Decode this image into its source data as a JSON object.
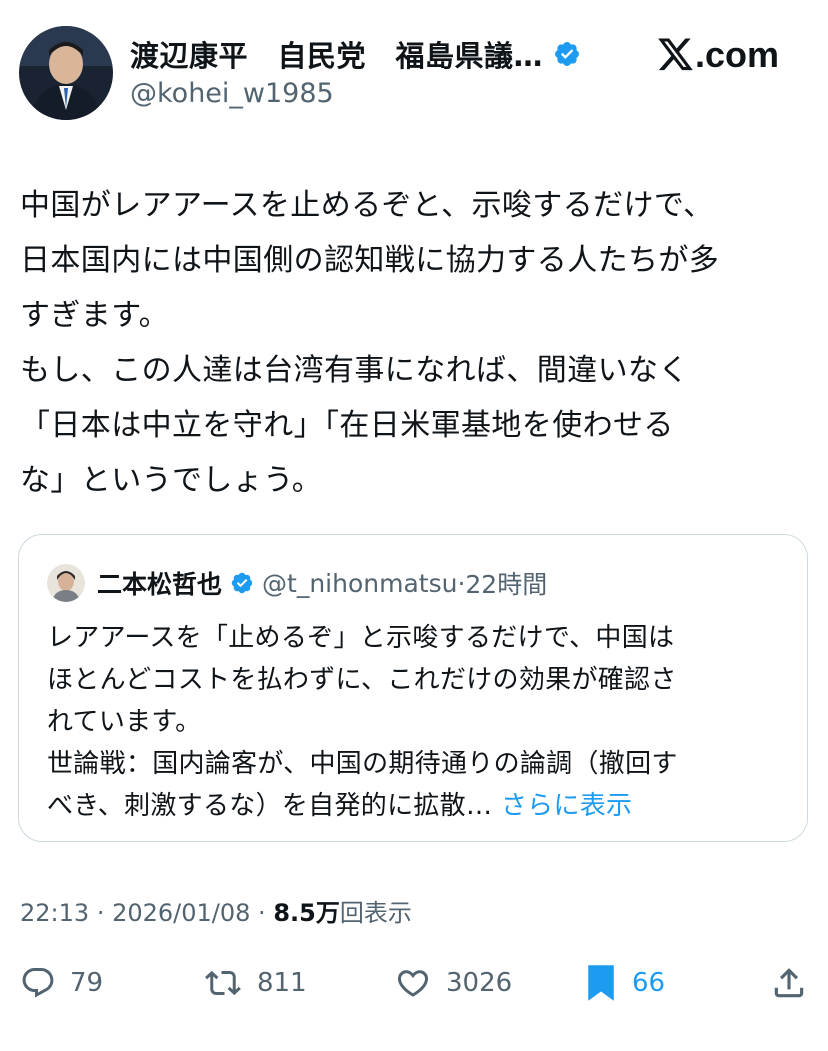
{
  "author": {
    "name": "渡辺康平　自民党　福島県議…",
    "handle": "@kohei_w1985"
  },
  "brand": {
    "logo_text": "com"
  },
  "tweet": {
    "lines": [
      "中国がレアアースを止めるぞと、示唆するだけで、",
      "日本国内には中国側の認知戦に協力する人たちが多",
      "すぎます。",
      "もし、この人達は台湾有事になれば、間違いなく",
      "「日本は中立を守れ」「在日米軍基地を使わせる",
      "な」というでしょう。"
    ]
  },
  "quote": {
    "name": "二本松哲也",
    "handle": "@t_nihonmatsu",
    "time": "22時間",
    "lines": [
      "レアアースを「止めるぞ」と示唆するだけで、中国は",
      "ほとんどコストを払わずに、これだけの効果が確認さ",
      "れています。",
      "世論戦：国内論客が、中国の期待通りの論調（撤回す"
    ],
    "last_line": "べき、刺激するな）を自発的に拡散…",
    "show_more": "さらに表示"
  },
  "meta": {
    "time": "22:13",
    "date": "2026/01/08",
    "views": "8.5万",
    "views_label": "回表示"
  },
  "actions": {
    "replies": "79",
    "retweets": "811",
    "likes": "3026",
    "bookmarks": "66"
  },
  "colors": {
    "accent": "#1d9bf0",
    "secondary_text": "#536471",
    "border": "#cfd9de"
  }
}
